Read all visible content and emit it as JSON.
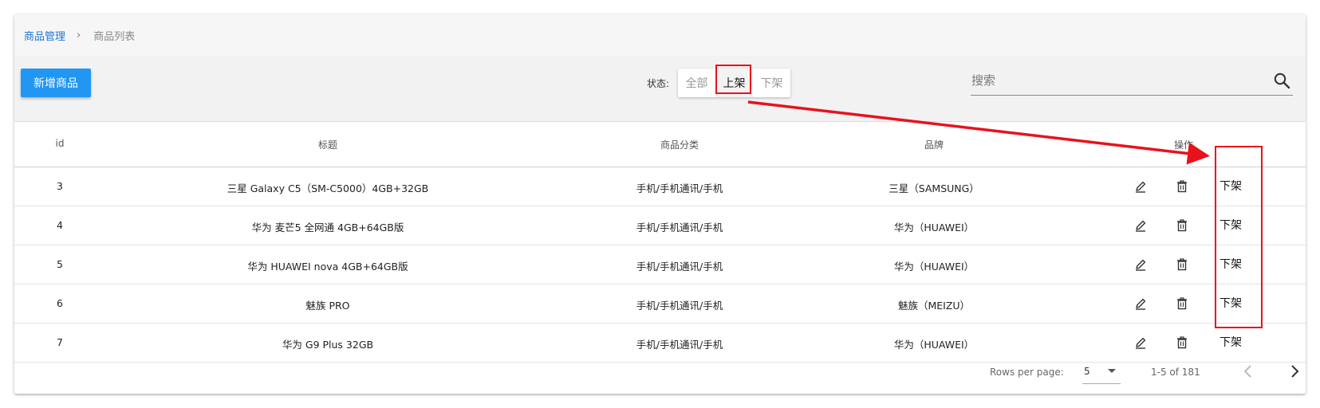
{
  "breadcrumb": {
    "root": "商品管理",
    "separator": "›",
    "current": "商品列表"
  },
  "toolbar": {
    "add_button": "新增商品",
    "status_label": "状态:",
    "status_options": [
      "全部",
      "上架",
      "下架"
    ],
    "selected_status": "上架",
    "search_placeholder": "搜索"
  },
  "table": {
    "columns": [
      "id",
      "标题",
      "商品分类",
      "品牌",
      "操作"
    ],
    "rows": [
      {
        "id": "3",
        "title": "三星 Galaxy C5（SM-C5000）4GB+32GB",
        "category": "手机/手机通讯/手机",
        "brand": "三星（SAMSUNG）",
        "action": "下架"
      },
      {
        "id": "4",
        "title": "华为 麦芒5 全网通 4GB+64GB版",
        "category": "手机/手机通讯/手机",
        "brand": "华为（HUAWEI）",
        "action": "下架"
      },
      {
        "id": "5",
        "title": "华为 HUAWEI nova 4GB+64GB版",
        "category": "手机/手机通讯/手机",
        "brand": "华为（HUAWEI）",
        "action": "下架"
      },
      {
        "id": "6",
        "title": "魅族 PRO",
        "category": "手机/手机通讯/手机",
        "brand": "魅族（MEIZU）",
        "action": "下架"
      },
      {
        "id": "7",
        "title": "华为 G9 Plus 32GB",
        "category": "手机/手机通讯/手机",
        "brand": "华为（HUAWEI）",
        "action": "下架"
      }
    ]
  },
  "footer": {
    "rows_per_page_label": "Rows per page:",
    "rows_per_page_value": "5",
    "range": "1-5 of 181"
  },
  "colors": {
    "accent": "#2196f3",
    "annotation": "#e8121c",
    "link": "#1976d2"
  },
  "icons": [
    "chevron-right-icon",
    "search-icon",
    "edit-icon",
    "trash-icon",
    "caret-down-icon",
    "chevron-left-icon"
  ]
}
